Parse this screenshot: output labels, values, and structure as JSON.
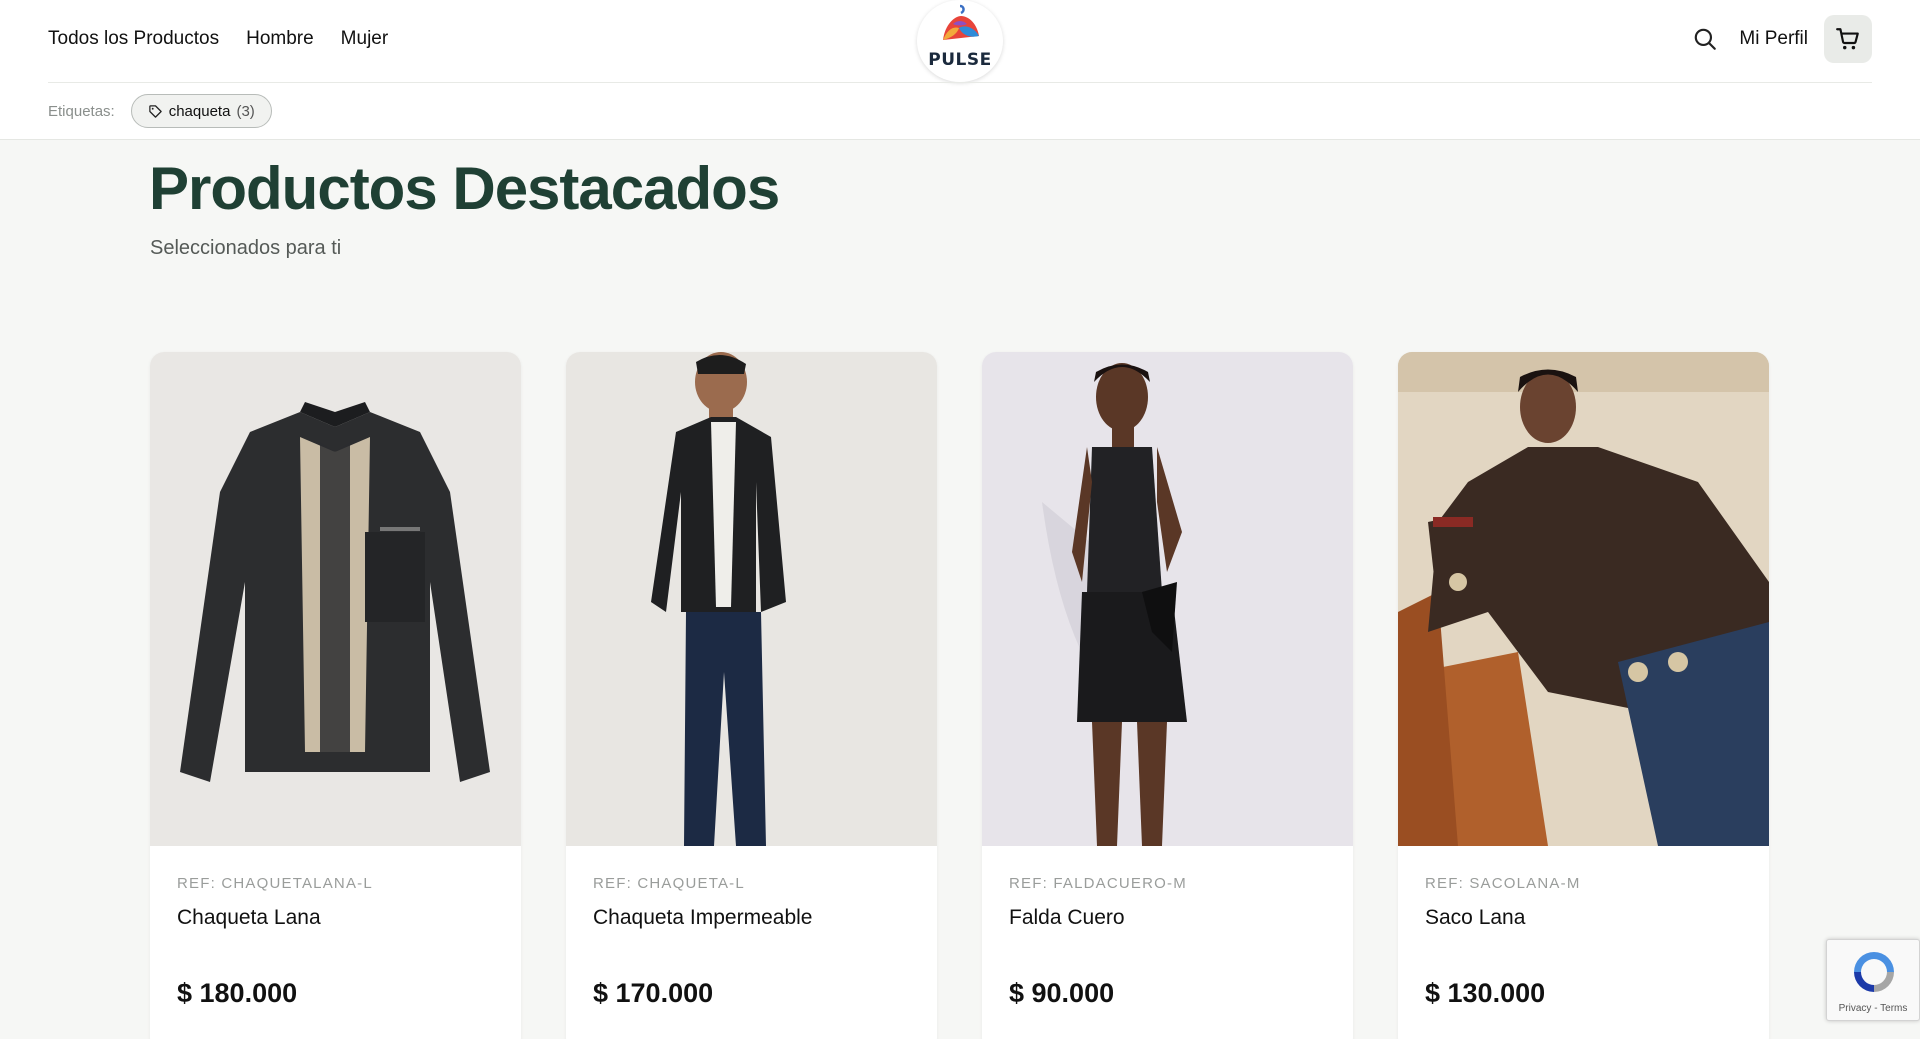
{
  "header": {
    "nav": [
      "Todos los Productos",
      "Hombre",
      "Mujer"
    ],
    "logo_text": "PULSE",
    "profile_label": "Mi Perfil",
    "tags_label": "Etiquetas:",
    "tag": {
      "name": "chaqueta",
      "count": "(3)"
    }
  },
  "main": {
    "title": "Productos Destacados",
    "subtitle": "Seleccionados para ti"
  },
  "products": [
    {
      "ref": "REF: CHAQUETALANA-L",
      "name": "Chaqueta Lana",
      "price": "$ 180.000"
    },
    {
      "ref": "REF: CHAQUETA-L",
      "name": "Chaqueta Impermeable",
      "price": "$ 170.000"
    },
    {
      "ref": "REF: FALDACUERO-M",
      "name": "Falda Cuero",
      "price": "$ 90.000"
    },
    {
      "ref": "REF: SACOLANA-M",
      "name": "Saco Lana",
      "price": "$ 130.000"
    }
  ],
  "recaptcha": {
    "links": "Privacy - Terms"
  },
  "colors": {
    "title": "#1f4034",
    "page_bg": "#f6f7f5",
    "card_bg": "#ffffff"
  }
}
